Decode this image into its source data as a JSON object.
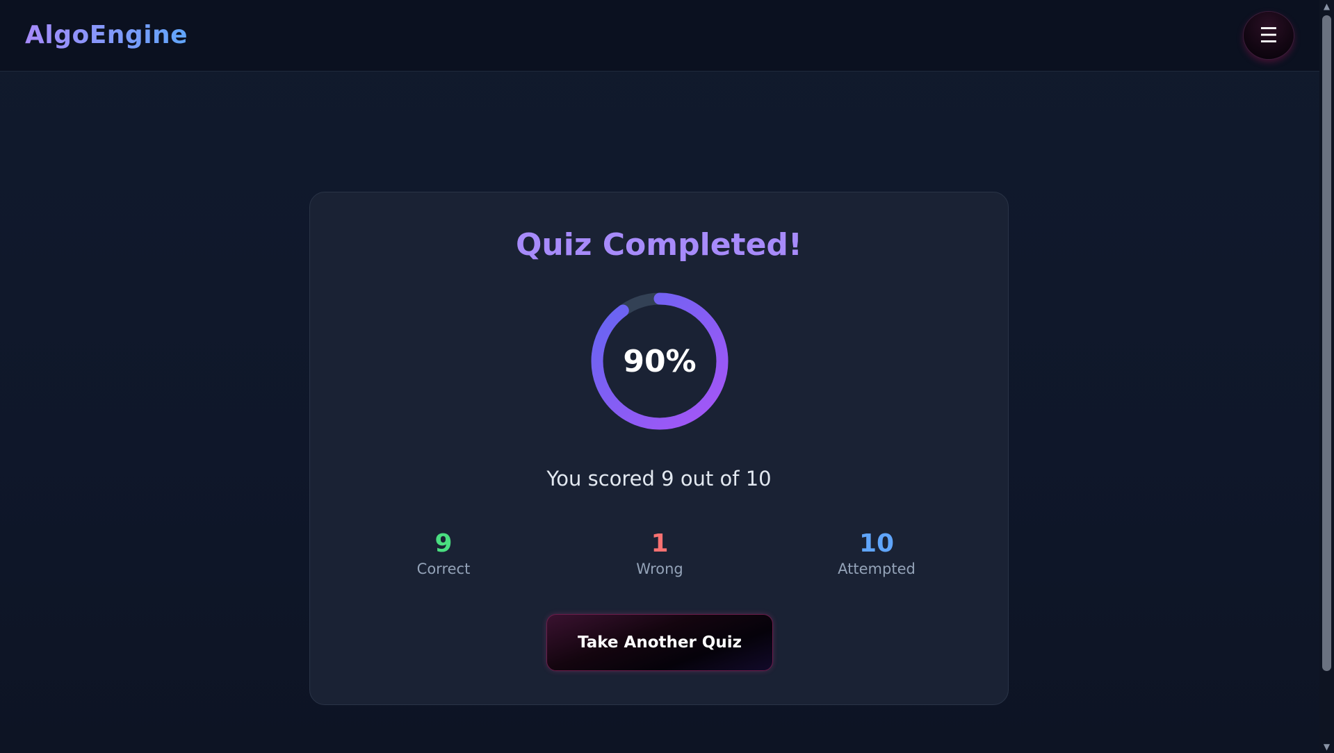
{
  "header": {
    "logo_text": "AlgoEngine",
    "menu_icon": "hamburger-icon",
    "menu_glyph": "☰"
  },
  "result": {
    "title": "Quiz Completed!",
    "percent_text": "90%",
    "percent_value": 0.9,
    "score_text": "You scored 9 out of 10",
    "stats": {
      "correct": {
        "value": "9",
        "label": "Correct"
      },
      "wrong": {
        "value": "1",
        "label": "Wrong"
      },
      "attempted": {
        "value": "10",
        "label": "Attempted"
      }
    },
    "action_label": "Take Another Quiz"
  },
  "colors": {
    "accent_purple": "#a78bfa",
    "ring_start": "#a855f7",
    "ring_end": "#6366f1",
    "ring_track": "#334155",
    "correct": "#4ade80",
    "wrong": "#f87171",
    "attempted": "#60a5fa"
  },
  "scrollbar": {
    "up_glyph": "▲",
    "down_glyph": "▼"
  }
}
